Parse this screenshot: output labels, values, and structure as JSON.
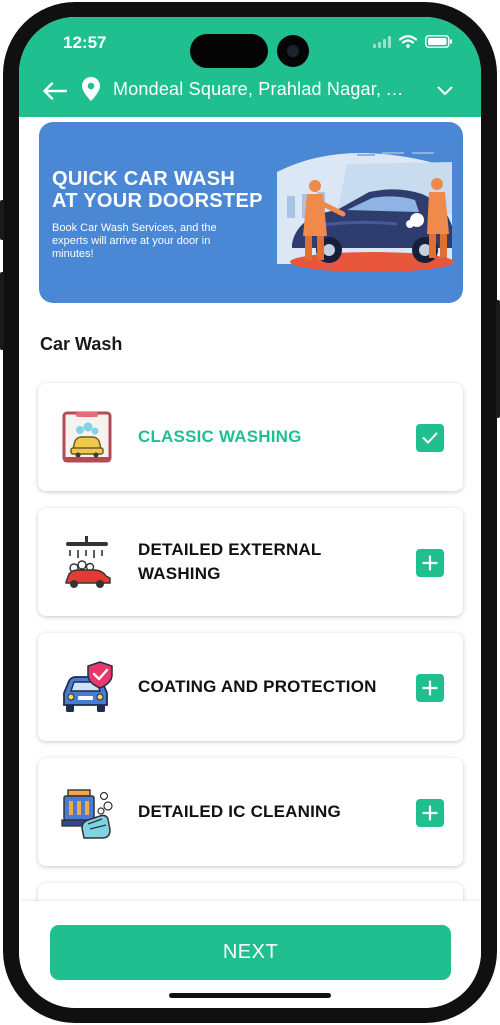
{
  "status_bar": {
    "time": "12:57"
  },
  "header": {
    "location": "Mondeal Square, Prahlad Nagar, Ah..."
  },
  "banner": {
    "title_line1": "QUICK CAR WASH",
    "title_line2": "AT YOUR DOORSTEP",
    "subtitle": "Book Car Wash Services, and the experts will arrive at your door in minutes!"
  },
  "section": {
    "title": "Car Wash"
  },
  "services": [
    {
      "label": "CLASSIC WASHING",
      "selected": true,
      "icon": "car-wash-tunnel-icon"
    },
    {
      "label": "DETAILED EXTERNAL WASHING",
      "selected": false,
      "icon": "car-shower-icon"
    },
    {
      "label": "COATING AND PROTECTION",
      "selected": false,
      "icon": "car-shield-icon"
    },
    {
      "label": "DETAILED IC CLEANING",
      "selected": false,
      "icon": "engine-cleaning-icon"
    }
  ],
  "footer": {
    "next_label": "NEXT"
  },
  "colors": {
    "accent": "#20bf8f",
    "banner": "#4a87d5",
    "selected_text": "#20bf8f"
  }
}
